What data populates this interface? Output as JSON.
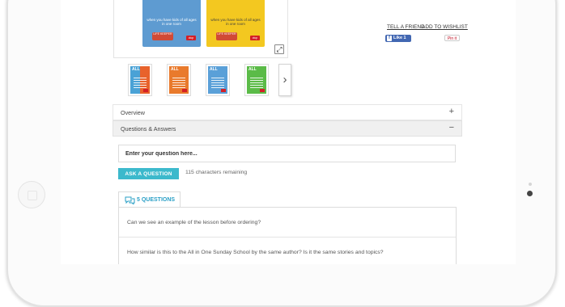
{
  "gallery": {
    "covers": [
      {
        "tagline": "when you have kids of all ages in one room",
        "badge": "LIFE KEEPER",
        "logo": "ctcp"
      },
      {
        "tagline": "when you have kids of all ages in one room",
        "badge": "LIFE KEEPER",
        "logo": "ctcp"
      }
    ],
    "expand_icon": "expand-icon",
    "thumbnails": [
      {
        "title": "ALL"
      },
      {
        "title": "ALL"
      },
      {
        "title": "ALL"
      },
      {
        "title": "ALL"
      }
    ],
    "next_icon": "chevron-right-icon"
  },
  "social": {
    "tell_friend": "TELL A FRIEND",
    "add_to_wishlist": "ADD TO WISHLIST",
    "fb_like": "Like 1",
    "pin_it": "Pin it"
  },
  "accordion": {
    "overview": {
      "label": "Overview",
      "toggle": "+"
    },
    "qa": {
      "label": "Questions & Answers",
      "toggle": "−"
    }
  },
  "question_form": {
    "placeholder": "Enter your question here...",
    "ask_button": "ASK A QUESTION",
    "chars_remaining": "115 characters remaining"
  },
  "questions": {
    "tab_label": "5 QUESTIONS",
    "accent": "#2a9fc6",
    "items": [
      {
        "text": "Can we see an example of the lesson before ordering?"
      },
      {
        "text": "How similar is this to the All in One Sunday School by the same author? Is it the same stories and topics?"
      }
    ]
  },
  "colors": {
    "ask_button": "#3cb9cc",
    "facebook": "#4267b2",
    "pinterest": "#bd081c"
  }
}
